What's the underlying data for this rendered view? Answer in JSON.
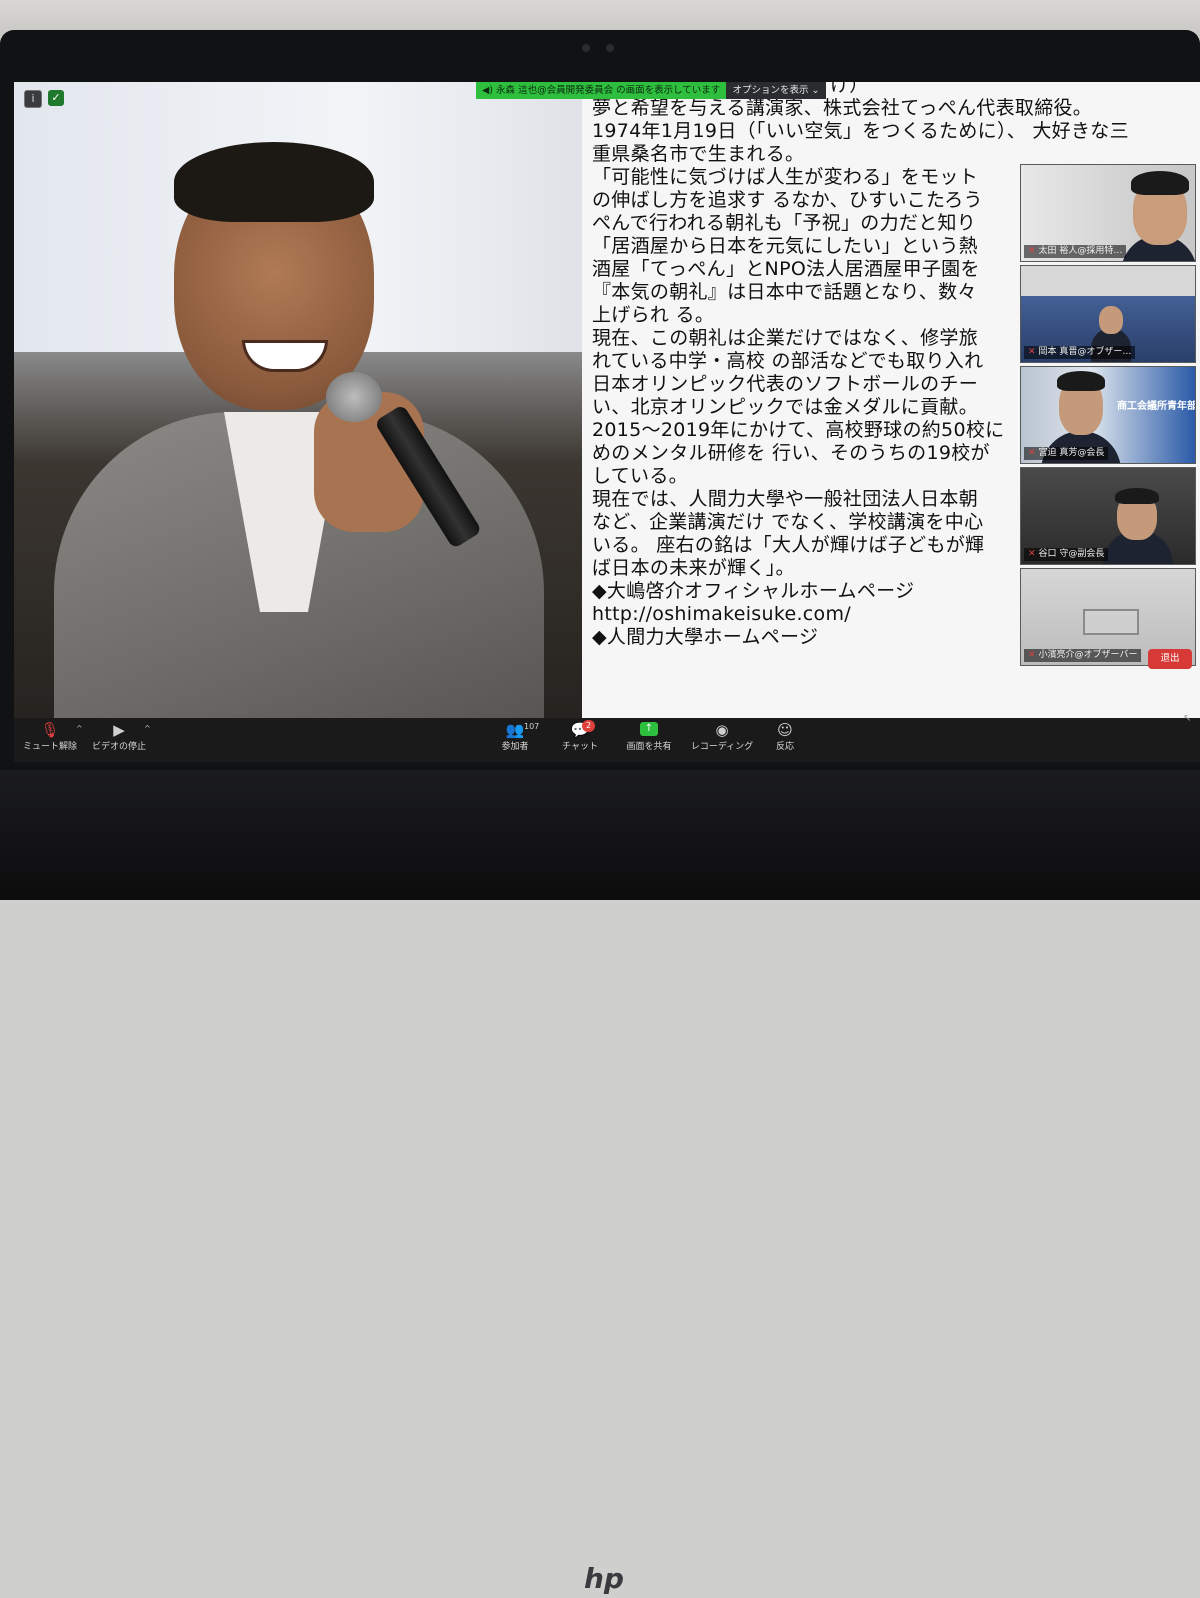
{
  "screen_share": {
    "banner": "永森 這也@会員開発委員会 の画面を表示しています",
    "options": "オプションを表示"
  },
  "slide": {
    "lines": [
      "大嶋啓介（おおしま けいすけ）",
      " 夢と希望を与える講演家、株式会社てっぺん代表取締役。",
      "1974年1月19日（「いい空気」をつくるために）、 大好きな三",
      "重県桑名市で生まれる。",
      "「可能性に気づけば人生が変わる」をモット",
      "の伸ばし方を追求す るなか、ひすいこたろう",
      "ぺんで行われる朝礼も「予祝」の力だと知り",
      "「居酒屋から日本を元気にしたい」という熱",
      "酒屋「てっぺん」とNPO法人居酒屋甲子園を",
      "『本気の朝礼』は日本中で話題となり、数々",
      "上げられ る。",
      "現在、この朝礼は企業だけではなく、修学旅",
      "れている中学・高校 の部活などでも取り入れ",
      "日本オリンピック代表のソフトボールのチー",
      "い、北京オリンピックでは金メダルに貢献。",
      "2015～2019年にかけて、高校野球の約50校に",
      "めのメンタル研修を 行い、そのうちの19校が",
      "している。",
      "現在では、人間力大學や一般社団法人日本朝",
      "など、企業講演だけ でなく、学校講演を中心",
      "いる。 座右の銘は「大人が輝けば子どもが輝",
      "ば日本の未来が輝く」。",
      "◆大嶋啓介オフィシャルホームページ",
      "http://oshimakeisuke.com/",
      "◆人間力大學ホームページ"
    ]
  },
  "participants": [
    {
      "name": "太田 裕人@採用特…"
    },
    {
      "name": "岡本 真晋@オブザー…"
    },
    {
      "name": "宮迫 真芳@会長",
      "overlay": "商工会議所青年部"
    },
    {
      "name": "谷口 守@副会長"
    },
    {
      "name": "小濱亮介@オブザーバー"
    }
  ],
  "toolbar": {
    "mute": "ミュート解除",
    "video": "ビデオの停止",
    "participants": "参加者",
    "participants_count": "107",
    "chat": "チャット",
    "chat_badge": "2",
    "share": "画面を共有",
    "record": "レコーディング",
    "reactions": "反応",
    "leave": "退出"
  },
  "colors": {
    "share_green": "#2fbf3e",
    "leave_red": "#d73a36",
    "mute_red": "#e04040"
  }
}
